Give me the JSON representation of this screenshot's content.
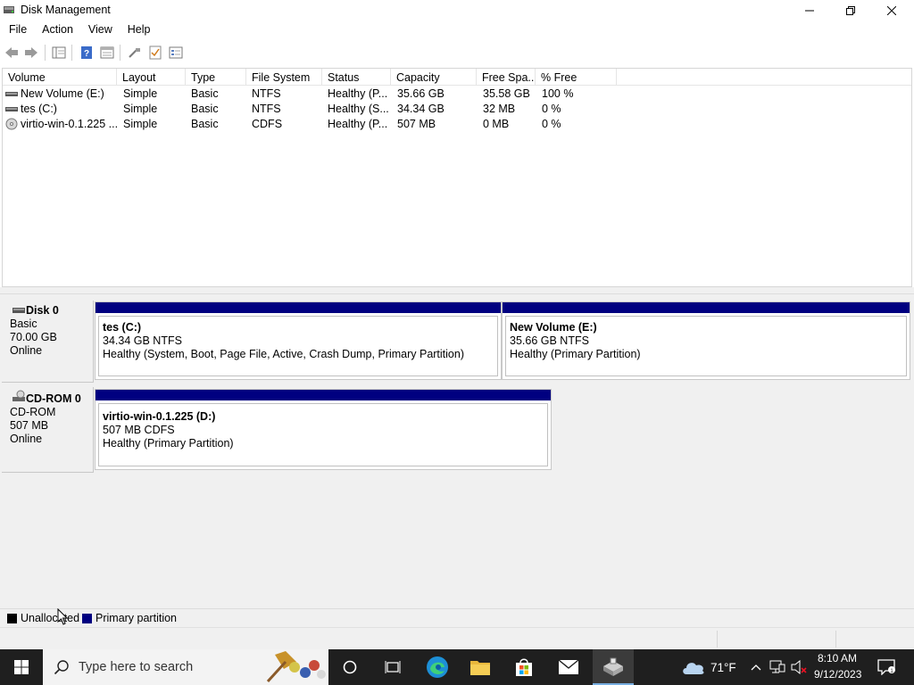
{
  "window": {
    "title": "Disk Management"
  },
  "menu": [
    "File",
    "Action",
    "View",
    "Help"
  ],
  "volume_list": {
    "columns": [
      "Volume",
      "Layout",
      "Type",
      "File System",
      "Status",
      "Capacity",
      "Free Spa...",
      "% Free"
    ],
    "rows": [
      {
        "volume": "New Volume (E:)",
        "layout": "Simple",
        "type": "Basic",
        "fs": "NTFS",
        "status": "Healthy (P...",
        "capacity": "35.66 GB",
        "free": "35.58 GB",
        "pct": "100 %",
        "icon": "volume-icon"
      },
      {
        "volume": "tes (C:)",
        "layout": "Simple",
        "type": "Basic",
        "fs": "NTFS",
        "status": "Healthy (S...",
        "capacity": "34.34 GB",
        "free": "32 MB",
        "pct": "0 %",
        "icon": "volume-icon"
      },
      {
        "volume": "virtio-win-0.1.225 ...",
        "layout": "Simple",
        "type": "Basic",
        "fs": "CDFS",
        "status": "Healthy (P...",
        "capacity": "507 MB",
        "free": "0 MB",
        "pct": "0 %",
        "icon": "cd-volume-icon"
      }
    ]
  },
  "disks": [
    {
      "name": "Disk 0",
      "kind": "Basic",
      "size": "70.00 GB",
      "state": "Online",
      "partitions": [
        {
          "name": "tes  (C:)",
          "size": "34.34 GB NTFS",
          "status": "Healthy (System, Boot, Page File, Active, Crash Dump, Primary Partition)"
        },
        {
          "name": "New Volume  (E:)",
          "size": "35.66 GB NTFS",
          "status": "Healthy (Primary Partition)"
        }
      ]
    },
    {
      "name": "CD-ROM 0",
      "kind": "CD-ROM",
      "size": "507 MB",
      "state": "Online",
      "partitions": [
        {
          "name": "virtio-win-0.1.225  (D:)",
          "size": "507 MB CDFS",
          "status": "Healthy (Primary Partition)"
        }
      ]
    }
  ],
  "legend": [
    {
      "label": "Unallocated",
      "color": "#000000"
    },
    {
      "label": "Primary partition",
      "color": "#000080"
    }
  ],
  "taskbar": {
    "search_placeholder": "Type here to search",
    "weather": "71°F",
    "time": "8:10 AM",
    "date": "9/12/2023"
  },
  "colors": {
    "partition_bar": "#000080",
    "taskbar": "#1f1f1f"
  }
}
